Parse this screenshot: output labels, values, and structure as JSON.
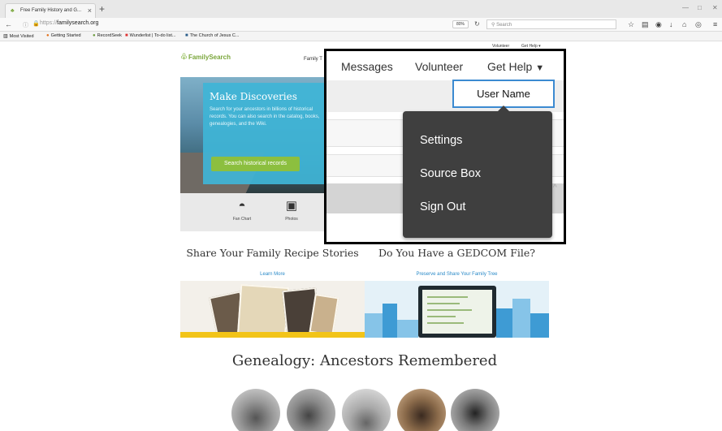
{
  "browser": {
    "tab_title": "Free Family History and G...",
    "url_prefix": "https://",
    "url_domain": "familysearch.org",
    "zoom": "80%",
    "search_placeholder": "Search",
    "bookmarks": [
      "Most Visited",
      "Getting Started",
      "RecordSeek",
      "Wunderlist | To-do list...",
      "The Church of Jesus C..."
    ]
  },
  "page": {
    "top_nav": [
      "Volunteer",
      "Get Help ▾"
    ],
    "logo": "FamilySearch",
    "nav_partial": "Family T",
    "hero": {
      "title": "Make Discoveries",
      "text": "Search for your ancestors in billions of historical records. You can also search in the catalog, books, genealogies, and the Wiki.",
      "button": "Search historical records"
    },
    "tools": [
      {
        "label": "Fan Chart",
        "icon": "fan-chart-icon"
      },
      {
        "label": "Photos",
        "icon": "photos-icon"
      }
    ],
    "cards": [
      {
        "title": "Share Your Family Recipe Stories",
        "link": "Learn More"
      },
      {
        "title": "Do You Have a GEDCOM File?",
        "link": "Preserve and Share Your Family Tree"
      }
    ],
    "section_title": "Genealogy: Ancestors Remembered"
  },
  "overlay": {
    "nav": [
      "Messages",
      "Volunteer",
      "Get Help"
    ],
    "get_help_caret": "▼",
    "username": "User Name",
    "menu": [
      "Settings",
      "Source Box",
      "Sign Out"
    ]
  },
  "colors": {
    "accent_blue": "#3b8ad1",
    "menu_bg": "#3f3f3f",
    "hero_box": "#3fb5d7",
    "hero_button": "#8cbf3f",
    "brand_green": "#7aa63b"
  }
}
